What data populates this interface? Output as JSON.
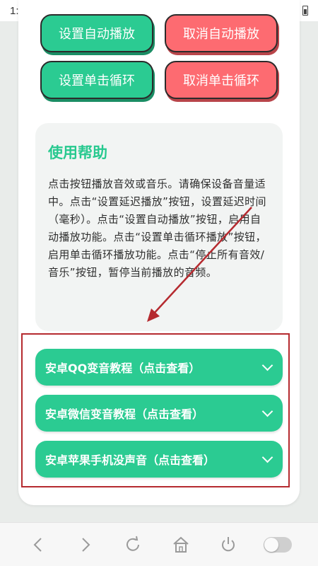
{
  "status_bar": {
    "time": "1:53",
    "app_badge": "A"
  },
  "buttons": {
    "set_autoplay": "设置自动播放",
    "cancel_autoplay": "取消自动播放",
    "set_click_loop": "设置单击循环",
    "cancel_click_loop": "取消单击循环"
  },
  "help": {
    "title": "使用帮助",
    "text": "点击按钮播放音效或音乐。请确保设备音量适中。点击“设置延迟播放”按钮，设置延迟时间（毫秒）。点击“设置自动播放”按钮，启用自动播放功能。点击“设置单击循环播放”按钮，启用单击循环播放功能。点击“停止所有音效/音乐”按钮，暂停当前播放的音频。"
  },
  "tutorials": [
    {
      "label": "安卓QQ变音教程（点击查看）"
    },
    {
      "label": "安卓微信变音教程（点击查看）"
    },
    {
      "label": "安卓苹果手机没声音（点击查看）"
    }
  ],
  "colors": {
    "accent_green": "#2bcb92",
    "accent_red": "#fd6b71",
    "annotation_red": "#b52a2f"
  }
}
